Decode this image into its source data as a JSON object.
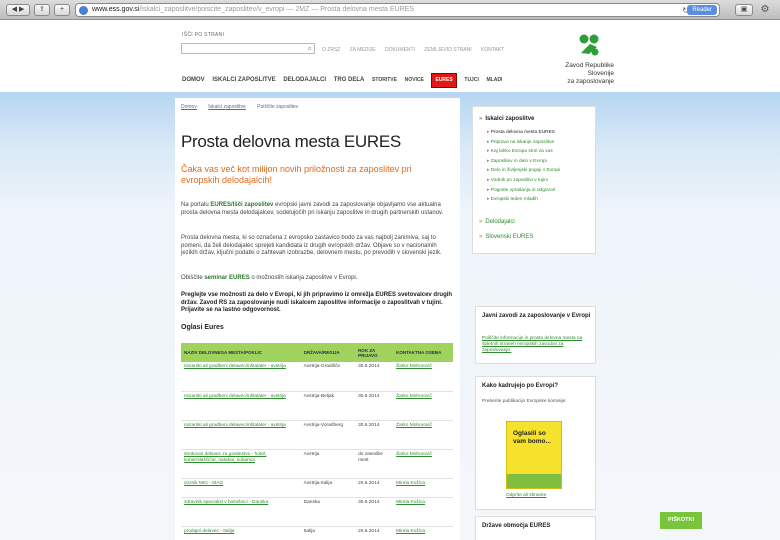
{
  "browser": {
    "url_domain": "www.ess.gov.si",
    "url_path": "/iskalci_zaposlitve/poiscite_zaposlitev/v_evropi — 2MZ — Prosta delovna mesta EURES",
    "reader_label": "Reader"
  },
  "header": {
    "search_label": "IŠČI PO STRANI",
    "util_nav": [
      "O ZRSZ",
      "ZA MEDIJE",
      "DOKUMENTI",
      "ZEMLJEVID STRANI",
      "KONTAKT"
    ],
    "logo_line1": "Zavod Republike Slovenije",
    "logo_line2": "za zaposlovanje",
    "main_nav": [
      "DOMOV",
      "ISKALCI ZAPOSLITVE",
      "DELODAJALCI",
      "TRG DELA",
      "STORITVE",
      "NOVICE",
      "EURES",
      "TUJCI",
      "MLADI"
    ]
  },
  "breadcrumbs": [
    "Domov",
    "Iskalci zaposlitve",
    "Poiščite zaposlitev"
  ],
  "main": {
    "title": "Prosta delovna mesta EURES",
    "lead": "Čaka vas več kot milijon novih priložnosti za zaposlitev pri evropskih delodajalcih!",
    "p1_prefix": "Na portalu ",
    "p1_link": "EURES/Išči zaposlitev",
    "p1_rest": " evropski javni zavodi za zaposlovanje objavljamo vse aktualna prosta delovna mesta delodajalcev, sodelujočih pri iskanju zaposlitve in drugih partnerskih ustanov.",
    "p2": "Prosta delovna mesta, ki so označena z evropsko zastavico bodo za vas najbolj zanimiva, saj to pomeni, da želi delodajalec sprejeti kandidata iz drugih evropskih držav. Objave so v nacionalnih jezikih držav, ključni podatki o zahtevah izobrazbe, delovnem mestu, po prevodih v slovenski jezik.",
    "p3_prefix": "Obiščite ",
    "p3_link": "seminar EURES",
    "p3_rest": " o možnostih iskanja zaposlitve v Evropi.",
    "p4": "Preglejte vse možnosti za delo v Evropi, ki jih pripravimo iz omrežja EURES svetovalcev drugih držav. Zavod RS za zaposlovanje nudi iskalcem zaposlitve informacije o zaposlitvah v tujini. Prijavite se na lastno odgovornost.",
    "table_title": "Oglasi Eures",
    "table_headers": [
      "NAZIV DELOVNEGA MESTA/POKLIC",
      "DRŽAVA/REGIJA",
      "ROK ZA PRIJAVO",
      "KONTAKTNA OSEBA"
    ],
    "table_rows": [
      [
        "mizarski ali gradbeni delavec/inštalater - avstrija",
        "Avstrija-Gradišče",
        "30.6.2014",
        "Žarko Mohorovič"
      ],
      [
        "mizarski ali gradbeni delavec/inštalater - avstrija",
        "Avstrija-Beljak",
        "30.6.2014",
        "Žarko Mohorovič"
      ],
      [
        "mizarski ali gradbeni delavec/inštalater - avstrija",
        "Avstrija-Vorarlberg",
        "30.6.2014",
        "Žarko Mohorovič"
      ],
      [
        "strokovni delavec za gostinstvo - hotel, kuhar/slaščičar, natakar, sobarica",
        "Avstrija",
        "do zasedbe mest",
        "Žarko Mohorovič"
      ],
      [
        "voznik MIG - MAG",
        "Avstrija-Italija",
        "20.6.2014",
        "Mirela Kožica"
      ],
      [
        "zdravnik specialist v bolnišnici - Danska",
        "Danska",
        "30.6.2014",
        "Mirela Kožica"
      ],
      [
        "prodajni delavec - Italija",
        "Italija",
        "20.6.2014",
        "Mirela Kožica"
      ]
    ]
  },
  "sidebar": {
    "menu_title": "Iskalci zaposlitve",
    "menu_items": [
      "Prosta delovna mesta EURES",
      "Priprava na iskanje zaposlitve",
      "Kaj lahko Evropa stori za vas",
      "Zaposlitev in delo v Evropi",
      "Delo in življenjski pogoji v Evropi",
      "Vodnik po zaposlitvi v tujini",
      "Pogoste vprašanja in odgovori",
      "Evropski teden mladih"
    ],
    "link_employers": "Delodajalci",
    "link_eures": "Slovenski EURES",
    "box1_title": "Javni zavodi za zaposlovanje v Evropi",
    "box1_text": "Poiščite informacije in prosta delovna mesta na spletnih straneh evropskih zavodov za zaposlovanje.",
    "box2_title": "Kako kadrujejo po Evropi?",
    "box2_text": "Preberite publikacijo Evropske komisije:",
    "poster_text": "Oglasili so vam bomo...",
    "pdf_link": "Odprite ali shranite",
    "box3_title": "Države območja EURES"
  },
  "cookies_button": "PIŠKOTKI"
}
